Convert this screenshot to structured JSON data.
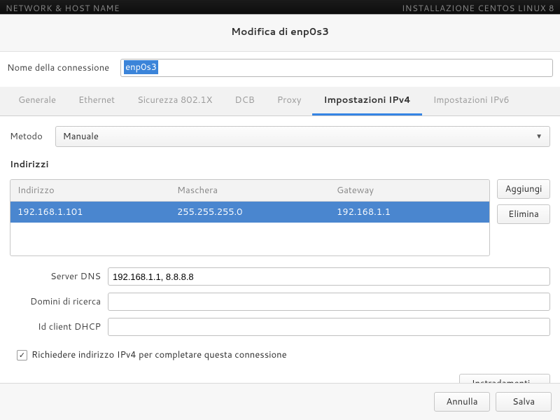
{
  "backdrop": {
    "left": "NETWORK & HOST NAME",
    "right": "INSTALLAZIONE CENTOS LINUX 8"
  },
  "dialog": {
    "title": "Modifica di enp0s3"
  },
  "conn_name": {
    "label": "Nome della connessione",
    "value": "enp0s3"
  },
  "tabs": {
    "items": [
      {
        "label": "Generale"
      },
      {
        "label": "Ethernet"
      },
      {
        "label": "Sicurezza 802.1X"
      },
      {
        "label": "DCB"
      },
      {
        "label": "Proxy"
      },
      {
        "label": "Impostazioni IPv4",
        "active": true
      },
      {
        "label": "Impostazioni IPv6"
      }
    ]
  },
  "ipv4": {
    "method_label": "Metodo",
    "method_value": "Manuale",
    "addresses_heading": "Indirizzi",
    "addresses_columns": {
      "address": "Indirizzo",
      "netmask": "Maschera",
      "gateway": "Gateway"
    },
    "addresses": [
      {
        "address": "192.168.1.101",
        "netmask": "255.255.255.0",
        "gateway": "192.168.1.1",
        "selected": true
      }
    ],
    "add_button": "Aggiungi",
    "delete_button": "Elimina",
    "dns_label": "Server DNS",
    "dns_value": "192.168.1.1, 8.8.8.8",
    "search_label": "Domini di ricerca",
    "search_value": "",
    "dhcp_client_label": "Id client DHCP",
    "dhcp_client_value": "",
    "require_ipv4_checked": true,
    "require_ipv4_label": "Richiedere indirizzo IPv4 per completare questa connessione",
    "routes_button": "Instradamenti…"
  },
  "buttons": {
    "cancel": "Annulla",
    "save": "Salva"
  }
}
